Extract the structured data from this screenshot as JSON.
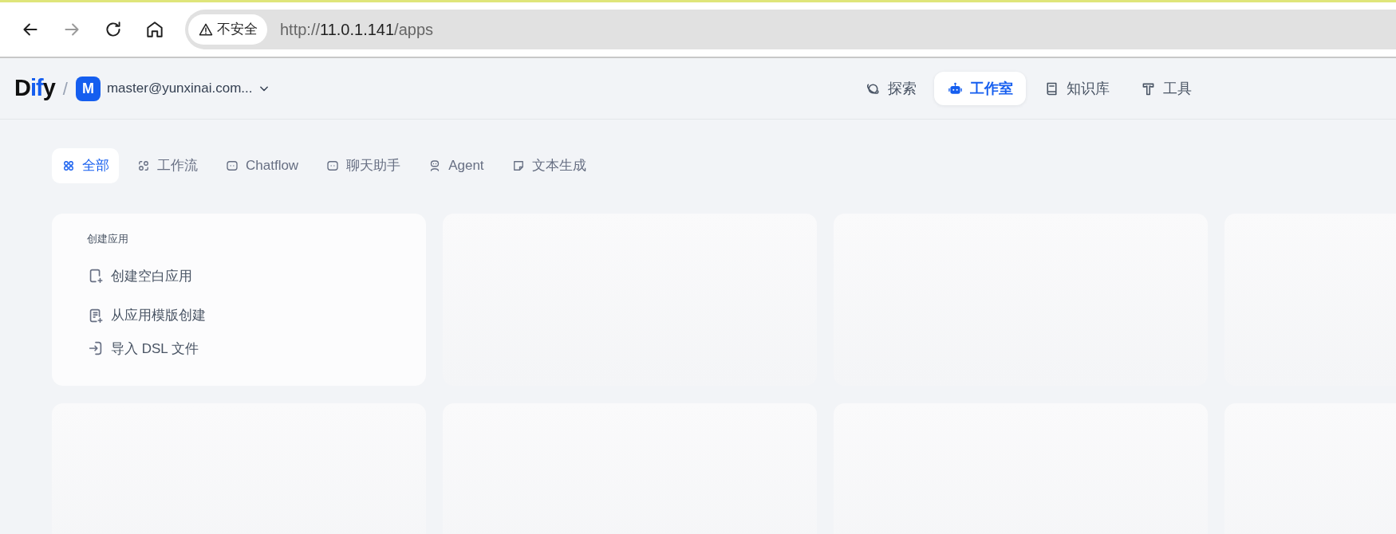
{
  "browser": {
    "back": {
      "disabled": false
    },
    "forward": {
      "disabled": true
    },
    "security_label": "不安全",
    "url": [
      {
        "text": "http://",
        "emphasis": false
      },
      {
        "text": "11.0.1.141",
        "emphasis": true
      },
      {
        "text": "/apps",
        "emphasis": false
      }
    ]
  },
  "header": {
    "logo": [
      {
        "text": "D",
        "accent": false
      },
      {
        "text": "if",
        "accent": true
      },
      {
        "text": "y",
        "accent": false
      }
    ],
    "divider": "/",
    "workspace": {
      "initial": "M",
      "name": "master@yunxinai.com..."
    },
    "nav": [
      {
        "label": "探索",
        "kind": "planet",
        "selected": false
      },
      {
        "label": "工作室",
        "kind": "robot",
        "selected": true
      },
      {
        "label": "知识库",
        "kind": "book",
        "selected": false
      },
      {
        "label": "工具",
        "kind": "hammer",
        "selected": false
      }
    ]
  },
  "tabs": [
    {
      "label": "全部",
      "kind": "grid",
      "selected": true
    },
    {
      "label": "工作流",
      "kind": "flow",
      "selected": false
    },
    {
      "label": "Chatflow",
      "kind": "chat",
      "selected": false
    },
    {
      "label": "聊天助手",
      "kind": "chat",
      "selected": false
    },
    {
      "label": "Agent",
      "kind": "agent",
      "selected": false
    },
    {
      "label": "文本生成",
      "kind": "note",
      "selected": false
    }
  ],
  "create_card": {
    "title": "创建应用",
    "actions": [
      {
        "label": "创建空白应用",
        "kind": "file-plus"
      },
      {
        "label": "从应用模版创建",
        "kind": "doc-plus"
      },
      {
        "label": "导入 DSL 文件",
        "kind": "import"
      }
    ]
  },
  "app_cards": [
    {
      "kind": "skeleton"
    },
    {
      "kind": "skeleton"
    },
    {
      "kind": "skeleton"
    },
    {
      "kind": "skeleton"
    },
    {
      "kind": "skeleton"
    },
    {
      "kind": "skeleton"
    },
    {
      "kind": "skeleton"
    }
  ]
}
